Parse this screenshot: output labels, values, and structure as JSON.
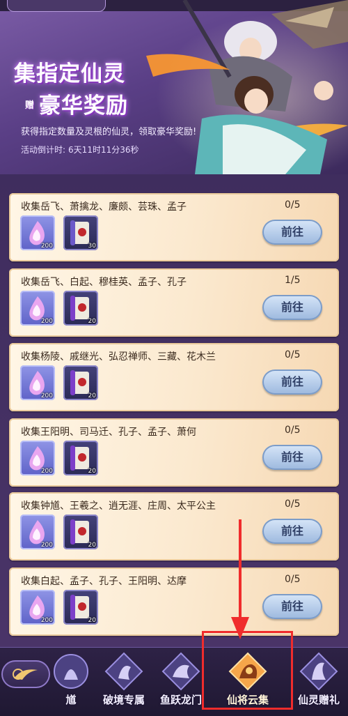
{
  "banner": {
    "title_line1": "集指定仙灵",
    "gift_tag": "赠",
    "title_line2": "豪华奖励",
    "subtitle": "获得指定数量及灵根的仙灵，领取豪华奖励!",
    "countdown_label": "活动倒计时:",
    "countdown_value": "6天11时11分36秒"
  },
  "tasks": [
    {
      "title": "收集岳飞、萧擒龙、廉颇、芸珠、孟子",
      "progress": "0/5",
      "item1_qty": "200",
      "item2_qty": "30",
      "button": "前往"
    },
    {
      "title": "收集岳飞、白起、穆桂英、孟子、孔子",
      "progress": "1/5",
      "item1_qty": "200",
      "item2_qty": "20",
      "button": "前往"
    },
    {
      "title": "收集杨陵、戚继光、弘忍禅师、三藏、花木兰",
      "progress": "0/5",
      "item1_qty": "200",
      "item2_qty": "20",
      "button": "前往"
    },
    {
      "title": "收集王阳明、司马迁、孔子、孟子、萧何",
      "progress": "0/5",
      "item1_qty": "200",
      "item2_qty": "20",
      "button": "前往"
    },
    {
      "title": "收集钟馗、王羲之、逍无涯、庄周、太平公主",
      "progress": "0/5",
      "item1_qty": "200",
      "item2_qty": "20",
      "button": "前往"
    },
    {
      "title": "收集白起、孟子、孔子、王阳明、达摩",
      "progress": "0/5",
      "item1_qty": "200",
      "item2_qty": "20",
      "button": "前往"
    }
  ],
  "nav": {
    "tabs": [
      {
        "label": "馗"
      },
      {
        "label": "破境专属"
      },
      {
        "label": "鱼跃龙门"
      },
      {
        "label": "仙将云集"
      },
      {
        "label": "仙灵赠礼"
      }
    ],
    "active_index": 3
  },
  "colors": {
    "highlight": "#f02c2c",
    "banner_bg": "#5a3f86",
    "card_bg": "#fbe9cf",
    "button_bg": "#b7cdea"
  },
  "icons": {
    "item1": "spirit-flame-icon",
    "item2": "scroll-icon",
    "back": "crescent-bird-icon"
  }
}
